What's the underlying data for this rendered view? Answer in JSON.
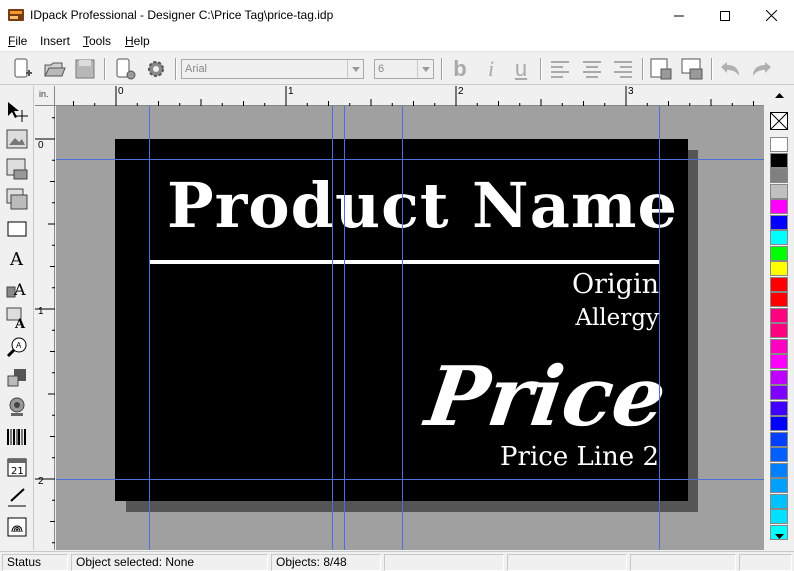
{
  "window": {
    "title": "IDpack Professional - Designer C:\\Price Tag\\price-tag.idp",
    "minimize_glyph": "—",
    "maximize_glyph": "☐",
    "close_glyph": "✕"
  },
  "menu": [
    {
      "label": "File"
    },
    {
      "label": "Insert"
    },
    {
      "label": "Tools"
    },
    {
      "label": "Help"
    }
  ],
  "toolbar": {
    "font_name": "Arial",
    "font_size": "6",
    "bold": "b",
    "italic": "i",
    "underline": "u"
  },
  "ruler": {
    "unit": "in.",
    "h_labels": [
      "0",
      "1",
      "2",
      "3"
    ],
    "v_labels": [
      "0",
      "1",
      "2"
    ]
  },
  "label": {
    "product_name": "Product Name",
    "origin": "Origin",
    "allergy": "Allergy",
    "price": "Price",
    "price_line_2": "Price Line 2",
    "background": "#000000",
    "text_color": "#ffffff"
  },
  "palette": [
    "#ffffff",
    "#000000",
    "#808080",
    "#c0c0c0",
    "#ff00ff",
    "#0000ff",
    "#00ffff",
    "#00ff00",
    "#ffff00",
    "#ff0000",
    "#ff0000",
    "#ff0080",
    "#ff0080",
    "#ff00c0",
    "#ff00ff",
    "#c000ff",
    "#8000ff",
    "#4000ff",
    "#0000ff",
    "#0040ff",
    "#0060ff",
    "#0080ff",
    "#00a0ff",
    "#00c0ff",
    "#00e0ff",
    "#00ffff"
  ],
  "status": {
    "status": "Status",
    "selected": "Object selected: None",
    "objects": "Objects: 8/48"
  },
  "colors": {
    "canvas_bg": "#a0a0a0",
    "guide": "#4a6fe0",
    "accent_close": "#e81123"
  }
}
